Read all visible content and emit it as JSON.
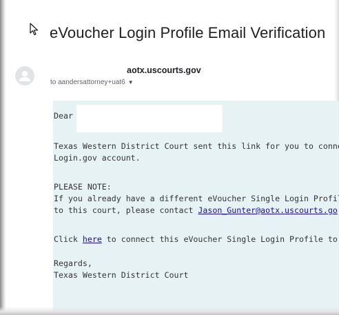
{
  "email": {
    "subject": "eVoucher Login Profile Email Verification",
    "sender": "aotx.uscourts.gov",
    "recipient_prefix": "to",
    "recipient": "aandersattorney+uat6",
    "icons": {
      "avatar": "person-avatar-icon",
      "expand": "triangle-down-icon",
      "cursor": "mouse-pointer-icon"
    }
  },
  "body": {
    "greeting": "Dear",
    "para1_line1": "Texas Western District Court sent this link for you to connect",
    "para1_line2": "Login.gov account.",
    "note_heading": "PLEASE NOTE:",
    "note_line1": "If you already have a different eVoucher Single Login Profile",
    "note_line2_prefix": "to this court, please contact",
    "note_email": "Jason_Gunter@aotx.uscourts.go",
    "click_prefix": "Click",
    "click_link": "here",
    "click_suffix": "to connect this eVoucher Single Login Profile to Lo",
    "regards": "Regards,",
    "signature": "Texas Western District Court"
  },
  "colors": {
    "panel_bg": "#e7f2f5",
    "link": "#1a0dab",
    "text": "#333333"
  }
}
